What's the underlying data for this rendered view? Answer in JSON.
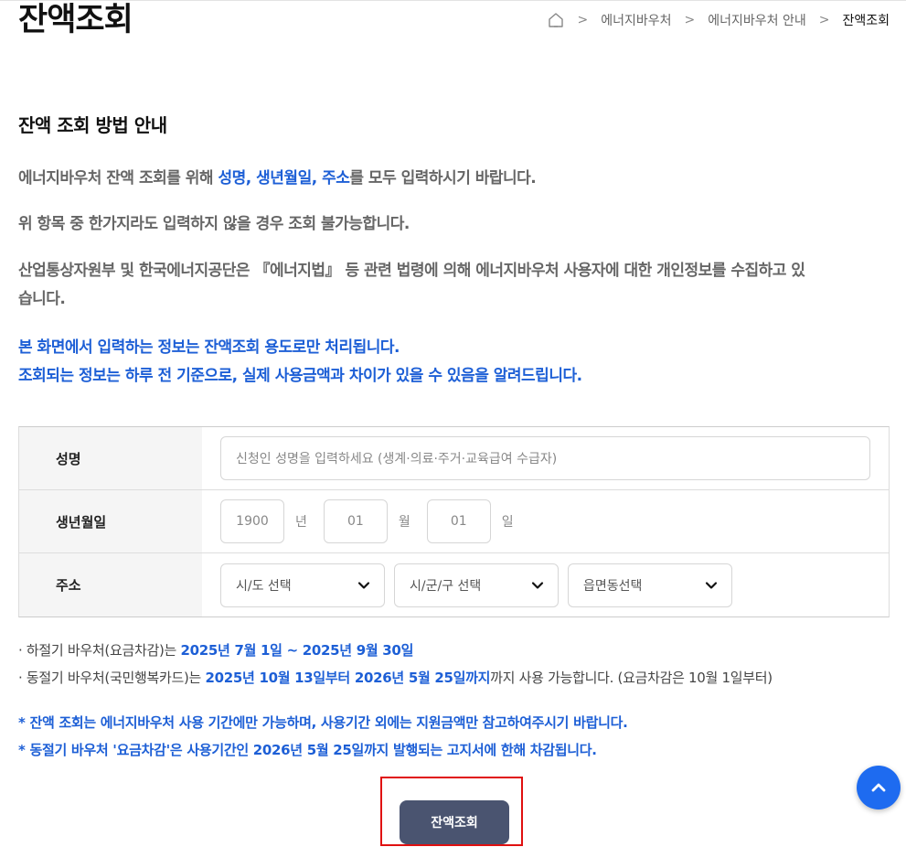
{
  "header": {
    "title": "잔액조회",
    "breadcrumb": [
      "에너지바우처",
      "에너지바우처 안내",
      "잔액조회"
    ],
    "home_icon": "home-icon"
  },
  "section": {
    "title": "잔액 조회 방법 안내",
    "p1_prefix": "에너지바우처 잔액 조회를 위해 ",
    "p1_highlight": "성명, 생년월일, 주소",
    "p1_suffix": "를 모두 입력하시기 바랍니다.",
    "p2": "위 항목 중 한가지라도 입력하지 않을 경우 조회 불가능합니다.",
    "p3_line1": "산업통상자원부 및 한국에너지공단은 『에너지법』 등 관련 법령에 의해 에너지바우처 사용자에 대한 개인정보를 수집하고 있",
    "p3_line2": "습니다.",
    "notice_line1": "본 화면에서 입력하는 정보는 잔액조회 용도로만 처리됩니다.",
    "notice_line2": "조회되는 정보는 하루 전 기준으로, 실제 사용금액과 차이가 있을 수 있음을 알려드립니다."
  },
  "form": {
    "name_label": "성명",
    "name_placeholder": "신청인 성명을 입력하세요 (생계·의료·주거·교육급여 수급자)",
    "birth_label": "생년월일",
    "year_placeholder": "1900",
    "year_unit": "년",
    "month_placeholder": "01",
    "month_unit": "월",
    "day_placeholder": "01",
    "day_unit": "일",
    "address_label": "주소",
    "sido_selected": "시/도 선택",
    "sigungu_selected": "시/군/구 선택",
    "eupmyeondong_selected": "읍면동선택"
  },
  "info": {
    "summer_prefix": "· 하절기 바우처(요금차감)는 ",
    "summer_period": "2025년 7월 1일 ~ 2025년 9월 30일",
    "winter_prefix": "· 동절기 바우처(국민행복카드)는 ",
    "winter_period": "2025년 10월 13일부터 2026년 5월 25일까지",
    "winter_suffix": "까지 사용 가능합니다. (요금차감은 10월 1일부터)",
    "note1": "* 잔액 조회는 에너지바우처 사용 기간에만 가능하며, 사용기간 외에는 지원금액만 참고하여주시기 바랍니다.",
    "note2": "* 동절기 바우처 '요금차감'은 사용기간인 2026년 5월 25일까지 발행되는 고지서에 한해 차감됩니다."
  },
  "actions": {
    "submit_label": "잔액조회",
    "top_icon": "chevron-up-icon"
  },
  "colors": {
    "accent": "#1d5fd6",
    "button": "#4a5470",
    "top_button": "#1e6bf0",
    "highlight_frame": "#e01010"
  }
}
